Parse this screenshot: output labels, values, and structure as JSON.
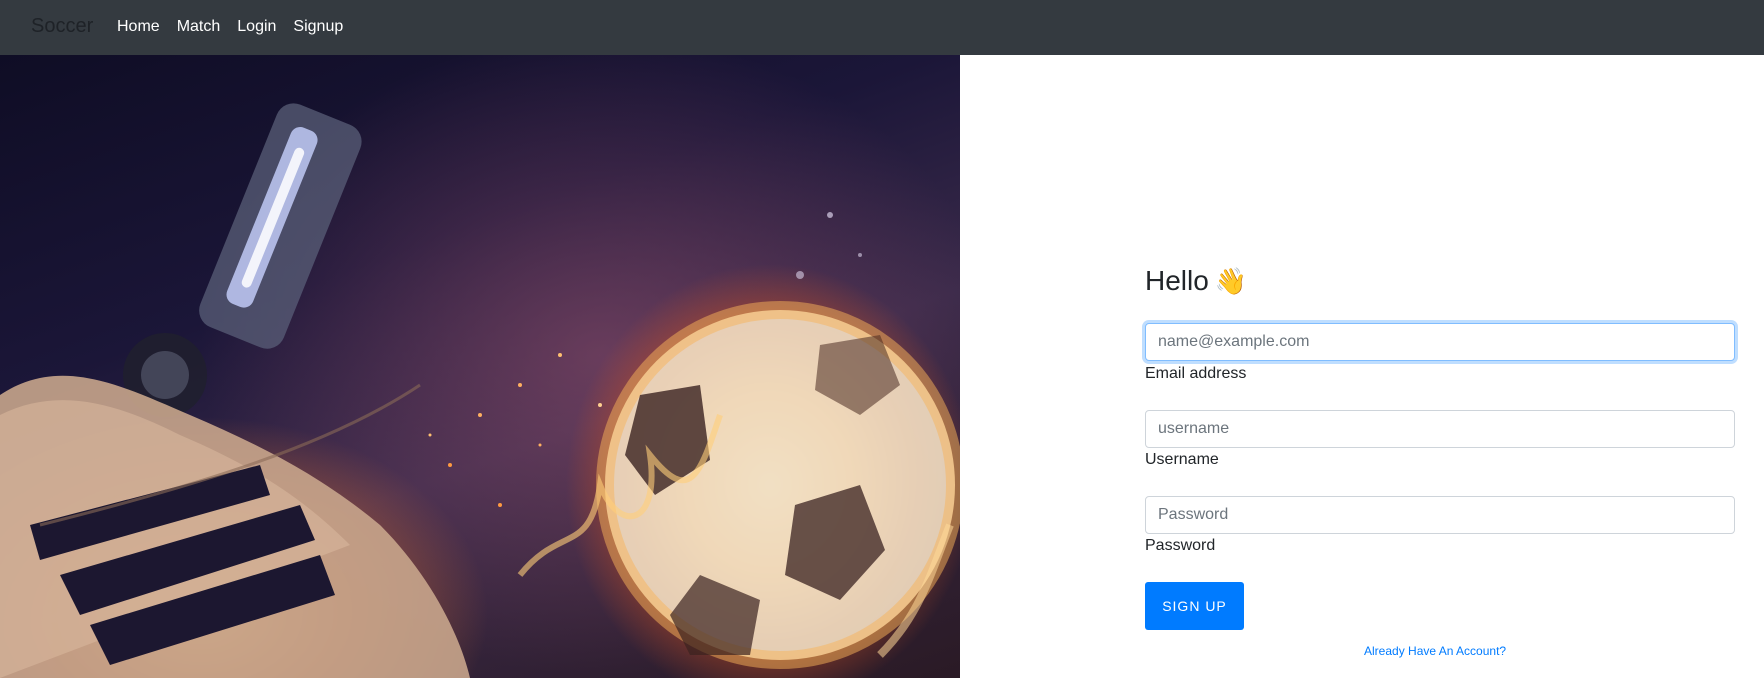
{
  "navbar": {
    "brand": "Soccer",
    "links": [
      "Home",
      "Match",
      "Login",
      "Signup"
    ]
  },
  "hero": {
    "image_description_icon": "soccer-boot-and-flaming-ball-image"
  },
  "form": {
    "title": "Hello",
    "title_emoji": "👋",
    "email": {
      "placeholder": "name@example.com",
      "label": "Email address",
      "value": ""
    },
    "username": {
      "placeholder": "username",
      "label": "Username",
      "value": ""
    },
    "password": {
      "placeholder": "Password",
      "label": "Password",
      "value": ""
    },
    "submit_label": "Sign Up",
    "login_link": "Already Have An Account?"
  },
  "colors": {
    "navbar_bg": "#343a40",
    "primary": "#007bff",
    "focus_border": "#80bdff"
  }
}
